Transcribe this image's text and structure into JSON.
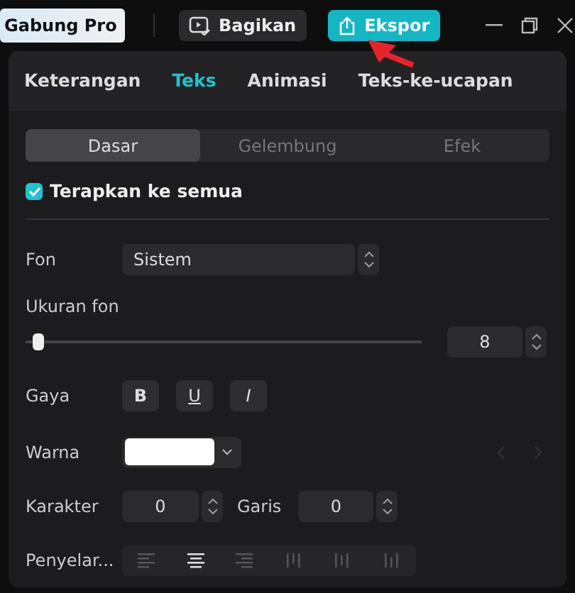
{
  "title_bar": {
    "pro_label": "Gabung Pro",
    "share_button": "Bagikan",
    "export_button": "Ekspor"
  },
  "tabs": [
    {
      "label": "Keterangan",
      "selected": false
    },
    {
      "label": "Teks",
      "selected": true
    },
    {
      "label": "Animasi",
      "selected": false
    },
    {
      "label": "Teks-ke-ucapan",
      "selected": false
    }
  ],
  "segments": [
    {
      "label": "Dasar",
      "selected": true
    },
    {
      "label": "Gelembung",
      "selected": false
    },
    {
      "label": "Efek",
      "selected": false
    }
  ],
  "apply_all": {
    "label": "Terapkan ke semua",
    "checked": true
  },
  "font": {
    "label": "Fon",
    "value": "Sistem"
  },
  "font_size": {
    "label": "Ukuran fon",
    "level": 0.02,
    "value": "8"
  },
  "style": {
    "label": "Gaya",
    "buttons": [
      "B",
      "U",
      "I"
    ]
  },
  "color": {
    "label": "Warna"
  },
  "spacing": {
    "char_label": "Karakter",
    "char_value": "0",
    "line_label": "Garis",
    "line_value": "0"
  },
  "align": {
    "label": "Penyelar...",
    "options": [
      {
        "kind": "left",
        "selected": false
      },
      {
        "kind": "center",
        "selected": true
      },
      {
        "kind": "right",
        "selected": false
      },
      {
        "kind": "top",
        "selected": false
      },
      {
        "kind": "middle",
        "selected": false
      },
      {
        "kind": "bottom",
        "selected": false
      }
    ]
  }
}
